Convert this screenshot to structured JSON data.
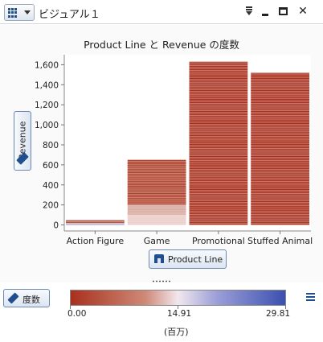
{
  "window": {
    "title": "ビジュアル１",
    "menu_icon": "grid-menu-icon",
    "controls": [
      "dropdown-icon",
      "minimize-icon",
      "maximize-icon",
      "close-icon"
    ]
  },
  "axes_buttons": {
    "y_label": "Revenue",
    "x_label": "Product Line"
  },
  "legend": {
    "label": "度数",
    "min_label": "0.00",
    "mid_label": "14.91",
    "max_label": "29.81",
    "unit_label": "(百万)",
    "colors": {
      "low": "#a8301d",
      "mid": "#f2e7ee",
      "high": "#3a50b0"
    }
  },
  "chart_data": {
    "type": "heatmap",
    "title": "Product Line と Revenue の度数",
    "xlabel": "Product Line",
    "ylabel": "Revenue",
    "categories": [
      "Action Figure",
      "Game",
      "Promotional",
      "Stuffed Animal"
    ],
    "ylim": [
      -60,
      1700
    ],
    "yticks": [
      0,
      200,
      400,
      600,
      800,
      1000,
      1200,
      1400,
      1600
    ],
    "ytick_labels": [
      "0",
      "200",
      "400",
      "600",
      "800",
      "1,000",
      "1,200",
      "1,400",
      "1,600"
    ],
    "columns": [
      {
        "category": "Action Figure",
        "max_revenue": 50,
        "rows": [
          [
            0,
            7,
            "#5a6fc0"
          ],
          [
            7,
            18,
            "#c89ea6"
          ],
          [
            18,
            50,
            "#b35a48"
          ]
        ]
      },
      {
        "category": "Game",
        "max_revenue": 650,
        "rows": [
          [
            0,
            100,
            "#e9c9c4"
          ],
          [
            100,
            200,
            "#d7a69d"
          ],
          [
            200,
            650,
            "#b0412c"
          ]
        ]
      },
      {
        "category": "Promotional",
        "max_revenue": 1630,
        "rows": [
          [
            0,
            1630,
            "#a8301d"
          ]
        ]
      },
      {
        "category": "Stuffed Animal",
        "max_revenue": 1520,
        "rows": [
          [
            0,
            1520,
            "#a8301d"
          ]
        ]
      }
    ]
  }
}
